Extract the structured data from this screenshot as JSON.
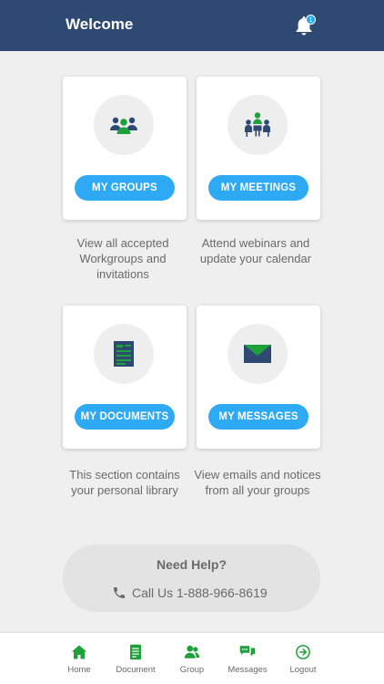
{
  "header": {
    "title": "Welcome",
    "notification_count": "1"
  },
  "cards": [
    {
      "button": "MY GROUPS",
      "description": "View all accepted Workgroups and invitations"
    },
    {
      "button": "MY MEETINGS",
      "description": "Attend webinars and update your calendar"
    },
    {
      "button": "MY DOCUMENTS",
      "description": "This section contains your personal library"
    },
    {
      "button": "MY MESSAGES",
      "description": "View emails and notices from all your groups"
    }
  ],
  "help": {
    "title": "Need Help?",
    "phone_text": "Call Us 1-888-966-8619"
  },
  "tabbar": {
    "items": [
      {
        "label": "Home",
        "icon": "home-icon"
      },
      {
        "label": "Document",
        "icon": "document-icon"
      },
      {
        "label": "Group",
        "icon": "group-icon"
      },
      {
        "label": "Messages",
        "icon": "messages-icon"
      },
      {
        "label": "Logout",
        "icon": "logout-icon"
      }
    ]
  },
  "colors": {
    "header_bg": "#2e4a72",
    "button_blue": "#2ea9f3",
    "icon_navy": "#2e4a72",
    "icon_green": "#1ea13a"
  }
}
